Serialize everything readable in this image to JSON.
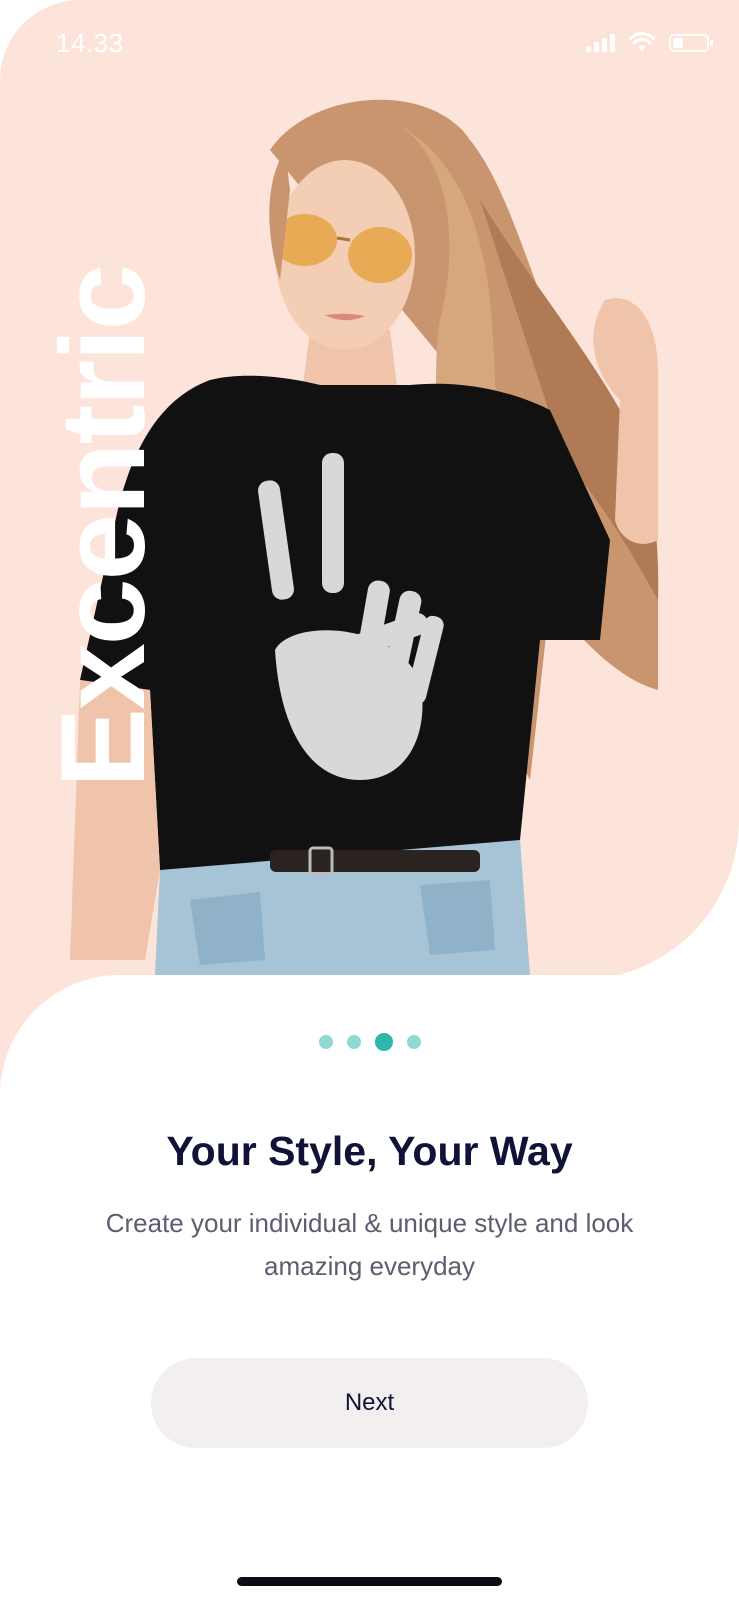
{
  "status_bar": {
    "time": "14.33",
    "icons": [
      "cellular-signal-icon",
      "wifi-icon",
      "battery-icon"
    ]
  },
  "hero": {
    "brand_word": "Excentric",
    "image": "model-in-skeleton-peace-sign-crop-top-and-sunglasses"
  },
  "pager": {
    "total": 4,
    "active_index": 2
  },
  "onboarding": {
    "title": "Your Style, Your Way",
    "subtitle": "Create your individual & unique style and look amazing everyday"
  },
  "actions": {
    "next_label": "Next"
  },
  "colors": {
    "hero_background": "#fde4da",
    "accent": "#2db6ab",
    "accent_light": "#8fd9d3",
    "title": "#101238",
    "button_background": "#f3efee"
  }
}
